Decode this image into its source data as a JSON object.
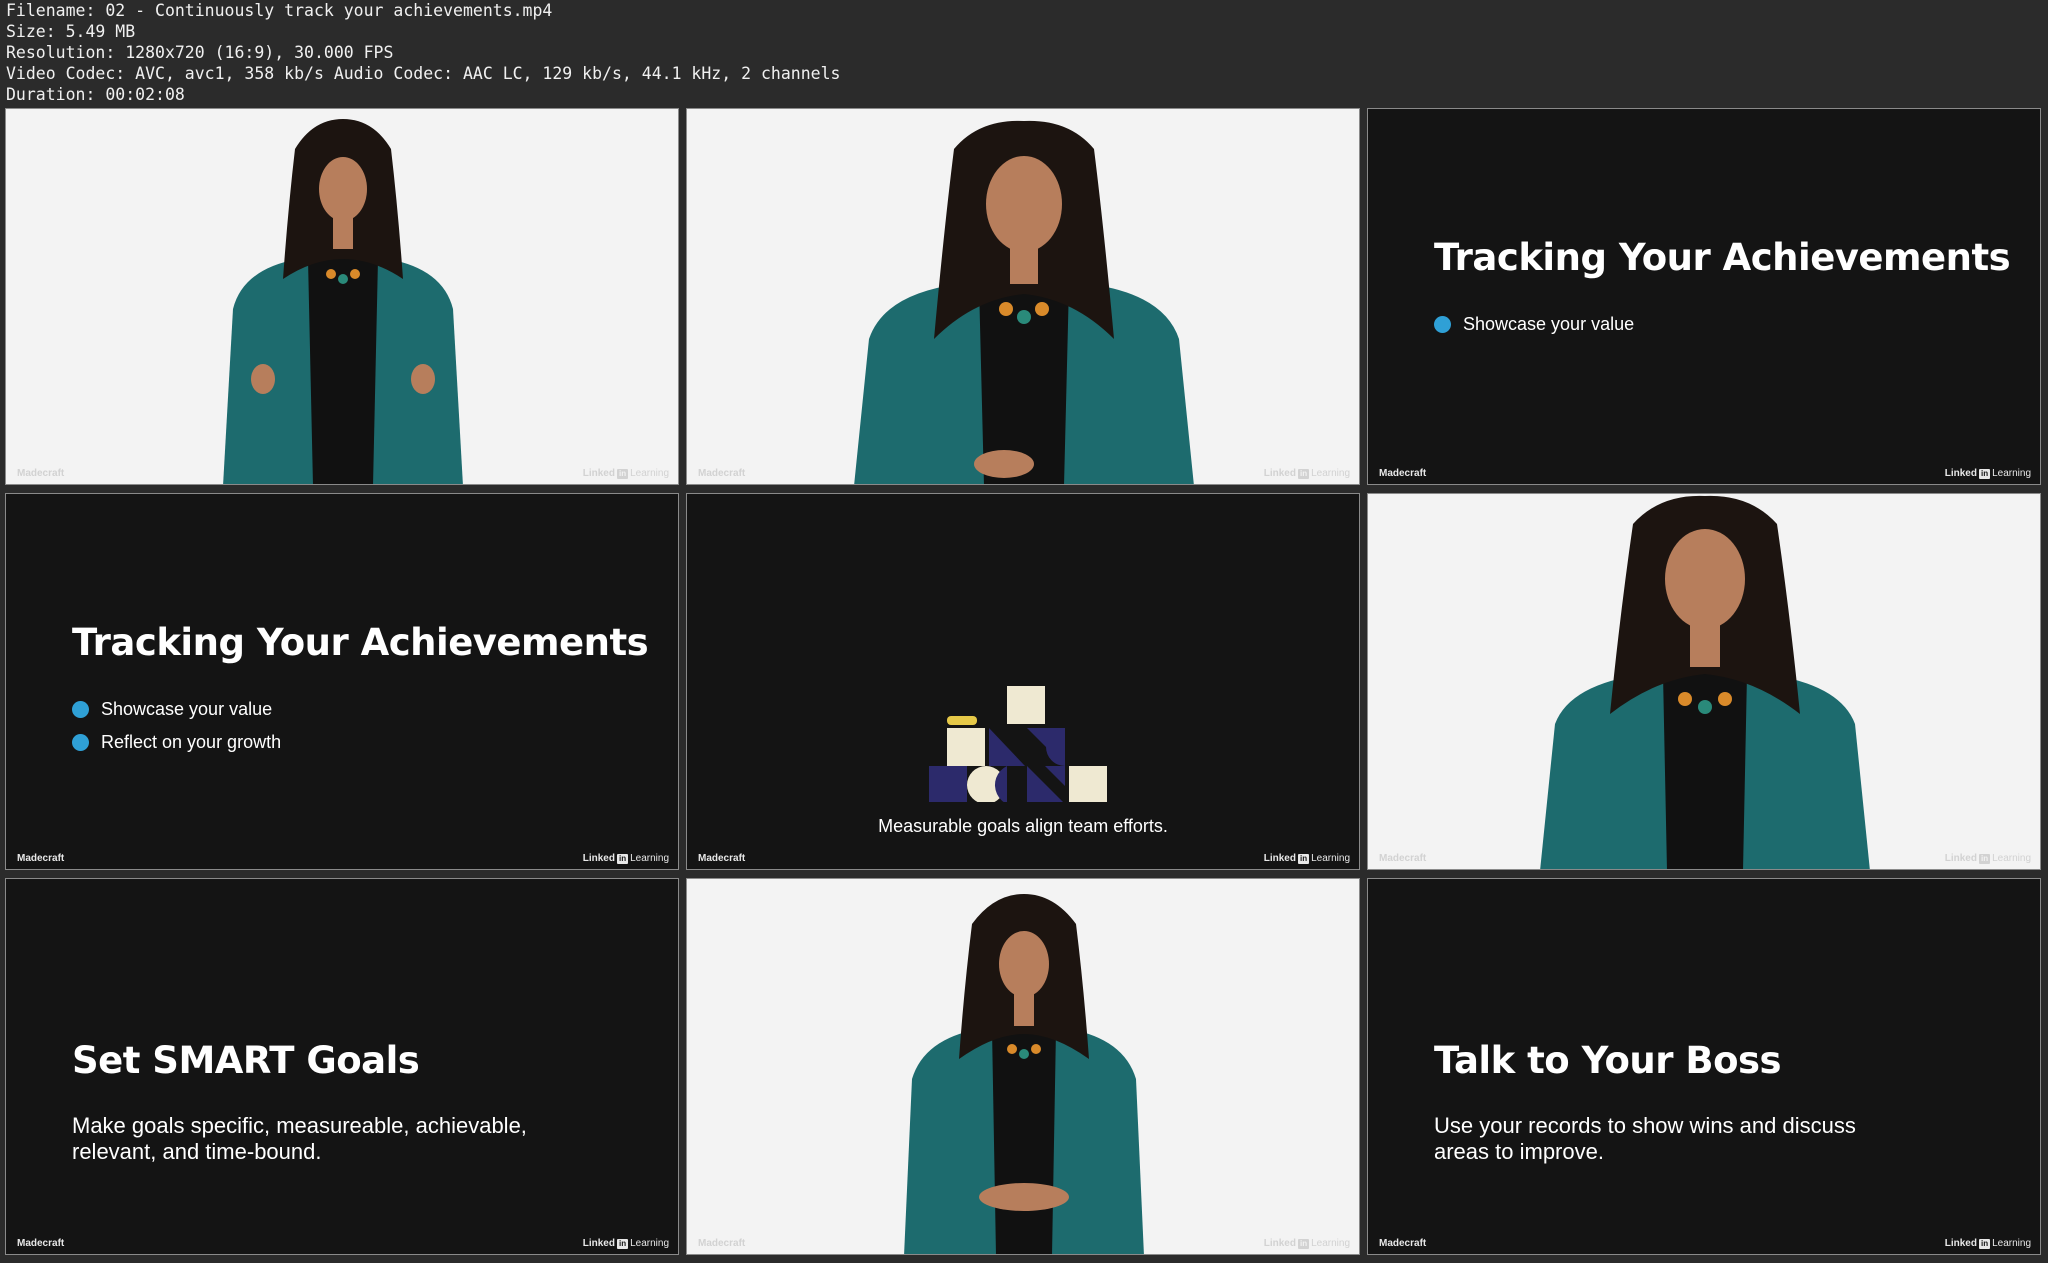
{
  "file_info": {
    "filename": "Filename: 02 - Continuously track your achievements.mp4",
    "size": "Size: 5.49 MB",
    "resolution": "Resolution: 1280x720 (16:9), 30.000 FPS",
    "codec": "Video Codec: AVC, avc1, 358 kb/s Audio Codec: AAC LC, 129 kb/s, 44.1 kHz, 2 channels",
    "duration": "Duration: 00:02:08"
  },
  "watermark": {
    "left": "Madecraft",
    "right_prefix": "Linked",
    "right_box": "in",
    "right_suffix": "Learning"
  },
  "slides": {
    "s3": {
      "title": "Tracking Your Achievements",
      "bullets": [
        "Showcase your value"
      ]
    },
    "s4": {
      "title": "Tracking Your Achievements",
      "bullets": [
        "Showcase your value",
        "Reflect on your growth"
      ]
    },
    "s5": {
      "caption": "Measurable goals align team efforts."
    },
    "s7": {
      "title": "Set SMART Goals",
      "body_line1": "Make goals specific, measureable, achievable,",
      "body_line2": "relevant, and time-bound."
    },
    "s9": {
      "title": "Talk to Your Boss",
      "body_line1": "Use your records to show wins and discuss",
      "body_line2": "areas to improve."
    }
  },
  "colors": {
    "bullet": "#2fa0d6",
    "jacket": "#1d6b6e",
    "slide_bg": "#141414",
    "studio_bg": "#f3f3f3",
    "logo_navy": "#2c2a6b",
    "logo_cream": "#efe9d2",
    "logo_yellow": "#e6c948"
  }
}
